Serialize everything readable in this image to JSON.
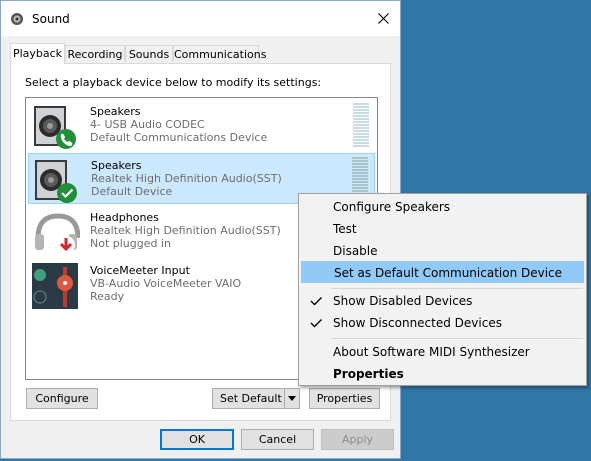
{
  "window": {
    "title": "Sound",
    "tabs": [
      {
        "label": "Playback",
        "active": true
      },
      {
        "label": "Recording",
        "active": false
      },
      {
        "label": "Sounds",
        "active": false
      },
      {
        "label": "Communications",
        "active": false
      }
    ],
    "instruction": "Select a playback device below to modify its settings:"
  },
  "devices": [
    {
      "name": "Speakers",
      "line1": "4- USB Audio CODEC",
      "line2": "Default Communications Device",
      "icon": "speaker-icon",
      "badge": "phone-badge-icon",
      "selected": false
    },
    {
      "name": "Speakers",
      "line1": "Realtek High Definition Audio(SST)",
      "line2": "Default Device",
      "icon": "speaker-icon",
      "badge": "check-badge-icon",
      "selected": true
    },
    {
      "name": "Headphones",
      "line1": "Realtek High Definition Audio(SST)",
      "line2": "Not plugged in",
      "icon": "headphones-icon",
      "badge": "down-arrow-badge-icon",
      "selected": false
    },
    {
      "name": "VoiceMeeter Input",
      "line1": "VB-Audio VoiceMeeter VAIO",
      "line2": "Ready",
      "icon": "voicemeeter-icon",
      "badge": "",
      "selected": false
    }
  ],
  "buttons": {
    "configure": "Configure",
    "set_default": "Set Default",
    "properties": "Properties",
    "ok": "OK",
    "cancel": "Cancel",
    "apply": "Apply"
  },
  "context_menu": {
    "items": [
      {
        "label": "Configure Speakers",
        "checked": false,
        "highlighted": false,
        "bold": false
      },
      {
        "label": "Test",
        "checked": false,
        "highlighted": false,
        "bold": false
      },
      {
        "label": "Disable",
        "checked": false,
        "highlighted": false,
        "bold": false
      },
      {
        "label": "Set as Default Communication Device",
        "checked": false,
        "highlighted": true,
        "bold": false
      },
      {
        "label": "Show Disabled Devices",
        "checked": true,
        "highlighted": false,
        "bold": false
      },
      {
        "label": "Show Disconnected Devices",
        "checked": true,
        "highlighted": false,
        "bold": false
      },
      {
        "label": "About Software MIDI Synthesizer",
        "checked": false,
        "highlighted": false,
        "bold": false
      },
      {
        "label": "Properties",
        "checked": false,
        "highlighted": false,
        "bold": true
      }
    ]
  },
  "colors": {
    "desktop": "#2f77a6",
    "selection": "#cce8ff",
    "menu_highlight": "#91c9f7",
    "accent": "#0078d7"
  }
}
